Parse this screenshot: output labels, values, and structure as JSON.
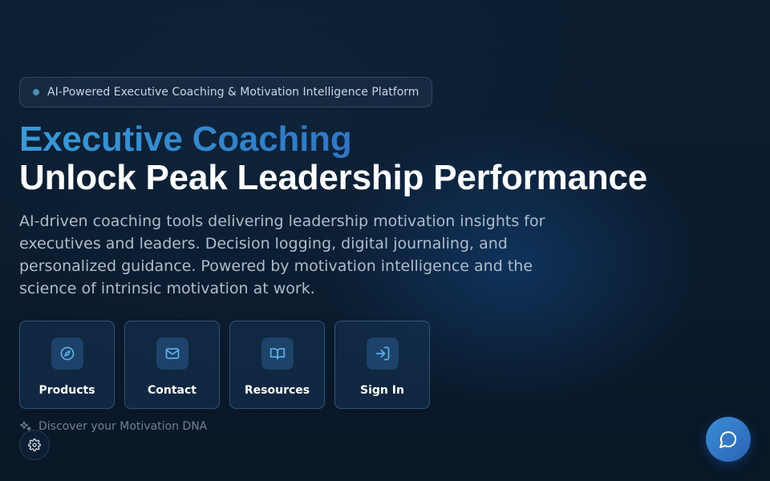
{
  "badge": {
    "text": "AI-Powered Executive Coaching & Motivation Intelligence Platform"
  },
  "hero": {
    "headline_gradient": "Executive Coaching",
    "headline": "Unlock Peak Leadership Performance",
    "description": "AI-driven coaching tools delivering leadership motivation insights for executives and leaders. Decision logging, digital journaling, and personalized guidance. Powered by motivation intelligence and the science of intrinsic motivation at work."
  },
  "tiles": [
    {
      "label": "Products",
      "icon": "compass-icon"
    },
    {
      "label": "Contact",
      "icon": "mail-icon"
    },
    {
      "label": "Resources",
      "icon": "book-open-icon"
    },
    {
      "label": "Sign In",
      "icon": "sign-in-icon"
    }
  ],
  "discover": {
    "text": "Discover your Motivation DNA",
    "icon": "sparkles-icon"
  },
  "floating": {
    "settings_icon": "gear-icon",
    "chat_icon": "chat-bubble-icon"
  },
  "colors": {
    "background": "#0a1a2c",
    "accent": "#3a9ad8",
    "tile_border": "#3f6d99",
    "chat_button": "#3b8fd6"
  }
}
